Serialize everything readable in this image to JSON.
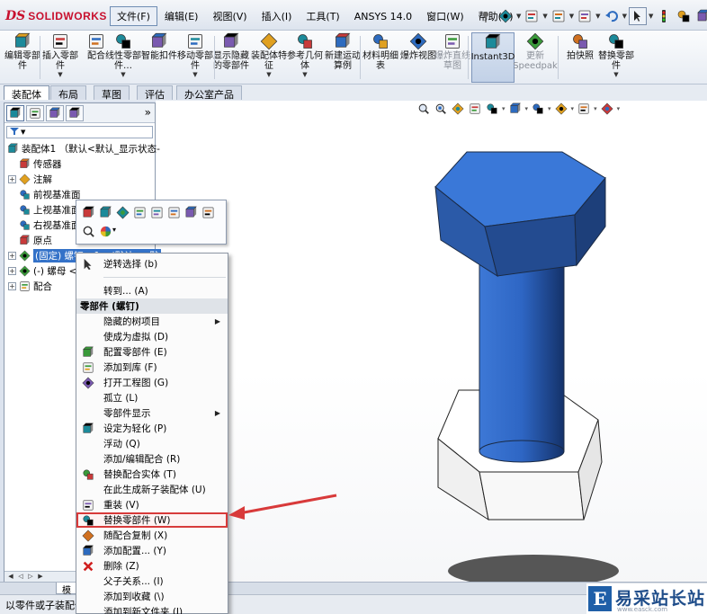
{
  "app": {
    "logo_ds": "DS",
    "logo_name": "SOLIDWORKS"
  },
  "menubar": {
    "items": [
      "文件(F)",
      "编辑(E)",
      "视图(V)",
      "插入(I)",
      "工具(T)",
      "ANSYS 14.0",
      "窗口(W)",
      "帮助(H)"
    ],
    "active_index": 0,
    "quick_icons": [
      "pin-icon",
      "new-doc-icon",
      "open-folder-icon",
      "save-icon",
      "print-icon",
      "undo-icon",
      "select-icon",
      "rebuild-icon",
      "file-properties-icon",
      "options-icon"
    ]
  },
  "ribbon": {
    "buttons": [
      {
        "label": "编辑零部件",
        "icon": "edit-component-icon",
        "arrow": false,
        "dim": false
      },
      {
        "label": "插入零部件",
        "icon": "insert-component-icon",
        "arrow": true,
        "dim": false
      },
      {
        "label": "配合",
        "icon": "mate-icon",
        "arrow": false,
        "dim": false
      },
      {
        "label": "线性零部件…",
        "icon": "linear-pattern-icon",
        "arrow": true,
        "dim": false
      },
      {
        "label": "智能扣件",
        "icon": "smart-fastener-icon",
        "arrow": false,
        "dim": false
      },
      {
        "label": "移动零部件",
        "icon": "move-component-icon",
        "arrow": true,
        "dim": false
      },
      {
        "label": "显示隐藏的零部件",
        "icon": "show-hidden-icon",
        "arrow": false,
        "dim": false
      },
      {
        "label": "装配体特征",
        "icon": "assembly-feature-icon",
        "arrow": true,
        "dim": false
      },
      {
        "label": "参考几何体",
        "icon": "reference-geometry-icon",
        "arrow": true,
        "dim": false
      },
      {
        "label": "新建运动算例",
        "icon": "motion-study-icon",
        "arrow": false,
        "dim": false
      },
      {
        "label": "材料明细表",
        "icon": "bom-icon",
        "arrow": false,
        "dim": false
      },
      {
        "label": "爆炸视图",
        "icon": "exploded-view-icon",
        "arrow": false,
        "dim": false
      },
      {
        "label": "爆炸直线草图",
        "icon": "explode-line-sketch-icon",
        "arrow": false,
        "dim": true
      },
      {
        "label": "Instant3D",
        "icon": "instant3d-icon",
        "arrow": false,
        "dim": false,
        "pressed": true
      },
      {
        "label": "更新Speedpak",
        "icon": "speedpak-icon",
        "arrow": false,
        "dim": true
      },
      {
        "label": "拍快照",
        "icon": "snapshot-icon",
        "arrow": false,
        "dim": false
      },
      {
        "label": "替换零部件",
        "icon": "replace-component-icon",
        "arrow": true,
        "dim": false
      }
    ]
  },
  "tabs": {
    "items": [
      "装配体",
      "布局",
      "草图",
      "评估",
      "办公室产品"
    ],
    "active_index": 0
  },
  "feature_tree": {
    "rows": [
      {
        "label": "装配体1 （默认<默认_显示状态-",
        "icon": "assembly-icon",
        "expander": "none",
        "indent": 0
      },
      {
        "label": "传感器",
        "icon": "sensor-icon",
        "expander": "blank",
        "indent": 1
      },
      {
        "label": "注解",
        "icon": "annotation-icon",
        "expander": "plus",
        "indent": 1
      },
      {
        "label": "前视基准面",
        "icon": "plane-icon",
        "expander": "blank",
        "indent": 1
      },
      {
        "label": "上视基准面",
        "icon": "plane-icon",
        "expander": "blank",
        "indent": 1
      },
      {
        "label": "右视基准面",
        "icon": "plane-icon",
        "expander": "blank",
        "indent": 1
      },
      {
        "label": "原点",
        "icon": "origin-icon",
        "expander": "blank",
        "indent": 1
      },
      {
        "label": "(固定) 螺钉 <1> (默认<<默",
        "icon": "part-icon",
        "expander": "plus",
        "indent": 1,
        "selected": true
      },
      {
        "label": "(-) 螺母 <1>",
        "icon": "part-icon",
        "expander": "plus",
        "indent": 1
      },
      {
        "label": "配合",
        "icon": "mates-folder-icon",
        "expander": "plus",
        "indent": 1
      }
    ],
    "panel_tab_icons": [
      "feature-manager-icon",
      "property-manager-icon",
      "config-manager-icon",
      "display-manager-icon"
    ],
    "more_label": "»"
  },
  "view_toolbar": {
    "icons": [
      "zoom-to-fit-icon",
      "zoom-area-icon",
      "previous-view-icon",
      "section-view-icon",
      "view-orientation-icon",
      "display-style-icon",
      "hide-show-icon",
      "edit-appearance-icon",
      "apply-scene-icon",
      "view-settings-icon"
    ]
  },
  "bolt": {
    "head_color": "#3a78d8",
    "shaft_color": "#2e66c4",
    "nut_color": "#f4f4f4"
  },
  "context_toolbar": {
    "icons": [
      "open-part-icon",
      "edit-part-icon",
      "component-properties-icon",
      "hide-components-icon",
      "change-transparency-icon",
      "mate-icon",
      "smart-fastener-icon",
      "configurations-icon",
      "zoom-to-selection-icon",
      "appearance-icon"
    ]
  },
  "context_menu": {
    "items": [
      {
        "type": "item",
        "label": "逆转选择 (b)",
        "icon": "cursor-icon"
      },
      {
        "type": "sep"
      },
      {
        "type": "item",
        "label": "转到... (A)",
        "icon": ""
      },
      {
        "type": "header",
        "label": "零部件 (螺钉)"
      },
      {
        "type": "item",
        "label": "隐藏的树项目",
        "icon": "",
        "submenu": true
      },
      {
        "type": "item",
        "label": "使成为虚拟 (D)",
        "icon": ""
      },
      {
        "type": "item",
        "label": "配置零部件 (E)",
        "icon": "configure-component-icon"
      },
      {
        "type": "item",
        "label": "添加到库 (F)",
        "icon": "add-to-library-icon"
      },
      {
        "type": "item",
        "label": "打开工程图 (G)",
        "icon": "open-drawing-icon"
      },
      {
        "type": "item",
        "label": "孤立 (L)",
        "icon": ""
      },
      {
        "type": "item",
        "label": "零部件显示",
        "icon": "",
        "submenu": true
      },
      {
        "type": "item",
        "label": "设定为轻化 (P)",
        "icon": "lightweight-icon"
      },
      {
        "type": "item",
        "label": "浮动 (Q)",
        "icon": ""
      },
      {
        "type": "item",
        "label": "添加/编辑配合 (R)",
        "icon": ""
      },
      {
        "type": "item",
        "label": "替换配合实体 (T)",
        "icon": "replace-mate-entities-icon"
      },
      {
        "type": "item",
        "label": "在此生成新子装配体 (U)",
        "icon": ""
      },
      {
        "type": "item",
        "label": "重装 (V)",
        "icon": "reload-icon"
      },
      {
        "type": "item",
        "label": "替换零部件 (W)",
        "icon": "replace-component-icon",
        "highlight": true
      },
      {
        "type": "item",
        "label": "随配合复制 (X)",
        "icon": "copy-with-mates-icon"
      },
      {
        "type": "item",
        "label": "添加配置... (Y)",
        "icon": "add-configuration-icon"
      },
      {
        "type": "item",
        "label": "删除 (Z)",
        "icon": "delete-icon"
      },
      {
        "type": "item",
        "label": "父子关系... (I)",
        "icon": ""
      },
      {
        "type": "item",
        "label": "添加到收藏 (\\)",
        "icon": ""
      },
      {
        "type": "item",
        "label": "添加到新文件夹 (J)",
        "icon": ""
      }
    ]
  },
  "annotation": {
    "arrow_color": "#d83a3a"
  },
  "bottom_tabs": {
    "model_tab": "模"
  },
  "status": {
    "text": "以零件或子装配体"
  },
  "watermark": {
    "logo_letter": "E",
    "text": "易采站长站",
    "url": "www.easck.com"
  }
}
